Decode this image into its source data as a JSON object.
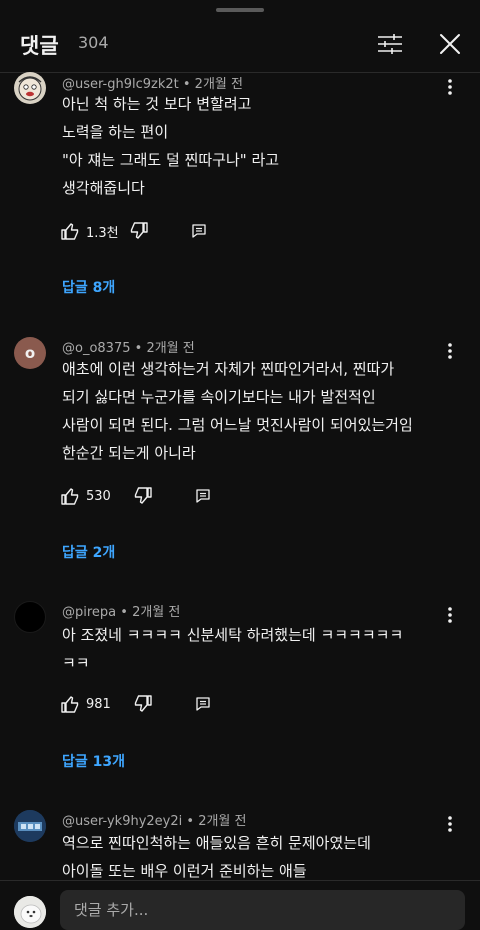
{
  "header": {
    "title": "댓글",
    "count": "304"
  },
  "comments": [
    {
      "author": "@user-gh9lc9zk2t",
      "time": "2개월 전",
      "lines": [
        "아닌 척 하는 것 보다 변할려고",
        "노력을 하는 편이",
        "\"아 쟤는 그래도 덜 찐따구나\" 라고",
        "생각해줍니다"
      ],
      "likes": "1.3천",
      "replies": "답글 8개"
    },
    {
      "author": "@o_o8375",
      "time": "2개월 전",
      "avatar_letter": "o",
      "lines": [
        "애초에 이런 생각하는거 자체가 찐따인거라서, 찐따가",
        "되기 싫다면 누군가를 속이기보다는 내가 발전적인",
        "사람이 되면 된다. 그럼 어느날 멋진사람이 되어있는거임",
        "한순간 되는게 아니라"
      ],
      "likes": "530",
      "replies": "답글 2개"
    },
    {
      "author": "@pirepa",
      "time": "2개월 전",
      "lines": [
        "아 조졌네 ㅋㅋㅋㅋ 신분세탁 하려했는데 ㅋㅋㅋㅋㅋㅋ",
        "ㅋㅋ"
      ],
      "likes": "981",
      "replies": "답글 13개"
    },
    {
      "author": "@user-yk9hy2ey2i",
      "time": "2개월 전",
      "lines": [
        "역으로 찐따인척하는 애들있음 흔히 문제아였는데",
        "아이돌 또는 배우 이런거 준비하는 애들"
      ]
    }
  ],
  "footer": {
    "placeholder": "댓글 추가..."
  },
  "colors": {
    "background": "#0f0f0f",
    "text": "#f1f1f1",
    "secondary": "#aaaaaa",
    "link": "#3ea6ff"
  }
}
